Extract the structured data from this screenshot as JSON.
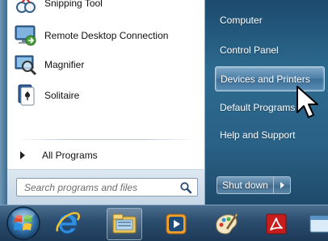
{
  "start_menu": {
    "programs": [
      {
        "label": "Snipping Tool",
        "icon": "snipping-tool-icon"
      },
      {
        "label": "Remote Desktop Connection",
        "icon": "remote-desktop-icon"
      },
      {
        "label": "Magnifier",
        "icon": "magnifier-icon"
      },
      {
        "label": "Solitaire",
        "icon": "solitaire-icon"
      }
    ],
    "all_programs_label": "All Programs",
    "search": {
      "placeholder": "Search programs and files",
      "icon": "search-icon"
    },
    "links": [
      {
        "label": "Computer"
      },
      {
        "label": "Control Panel"
      },
      {
        "label": "Devices and Printers",
        "highlighted": true
      },
      {
        "label": "Default Programs"
      },
      {
        "label": "Help and Support"
      }
    ],
    "shutdown_label": "Shut down"
  },
  "taskbar": {
    "items": [
      {
        "icon": "start-orb-icon"
      },
      {
        "icon": "internet-explorer-icon"
      },
      {
        "icon": "windows-explorer-icon"
      },
      {
        "icon": "media-player-icon"
      },
      {
        "icon": "paint-icon"
      },
      {
        "icon": "acrobat-icon"
      },
      {
        "icon": "app-icon"
      }
    ]
  },
  "colors": {
    "menu_background": "#2d6a8f",
    "highlight": "#4d7ea6",
    "taskbar": "#2b4c6d"
  }
}
